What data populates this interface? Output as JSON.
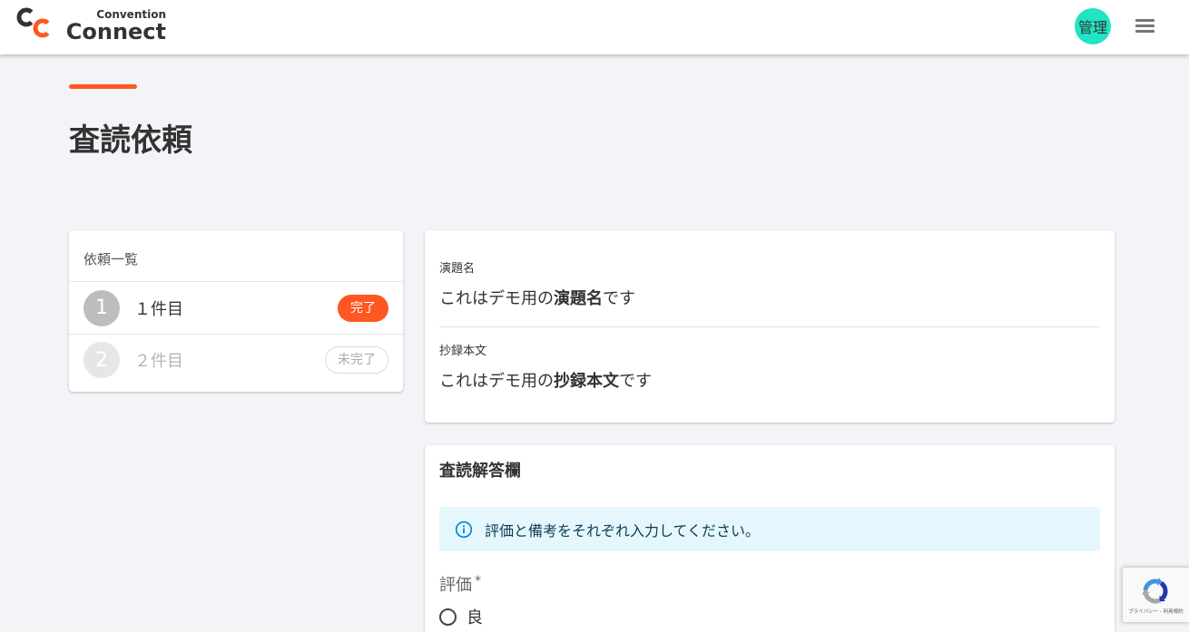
{
  "header": {
    "logo": {
      "mark": "CC",
      "line1": "Convention",
      "line2": "Connect"
    },
    "avatar_label": "管理",
    "menu_icon": "hamburger-menu-icon"
  },
  "page": {
    "title": "査読依頼"
  },
  "request_list": {
    "heading": "依頼一覧",
    "items": [
      {
        "number": "1",
        "label": "１件目",
        "status": "完了"
      },
      {
        "number": "2",
        "label": "２件目",
        "status": "未完了"
      }
    ]
  },
  "abstract": {
    "title_label": "演題名",
    "title_value": {
      "prefix": "これはデモ用の",
      "bold": "演題名",
      "suffix": "です"
    },
    "body_label": "抄録本文",
    "body_value": {
      "prefix": "これはデモ用の",
      "bold": "抄録本文",
      "suffix": "です"
    }
  },
  "review_form": {
    "heading": "査読解答欄",
    "info_icon": "info-icon",
    "info_message": "評価と備考をそれぞれ入力してください。",
    "rating_label": "評価",
    "required_mark": "*",
    "options": [
      "良"
    ]
  },
  "recaptcha": {
    "icon": "recaptcha-logo-icon",
    "privacy": "プライバシー",
    "separator": " - ",
    "terms": "利用規約"
  },
  "colors": {
    "accent": "#ff5722",
    "avatar": "#1fe5c4",
    "info_bg": "#e5f6fd",
    "info_icon": "#0288d1",
    "page_bg": "#f2f4f7"
  }
}
